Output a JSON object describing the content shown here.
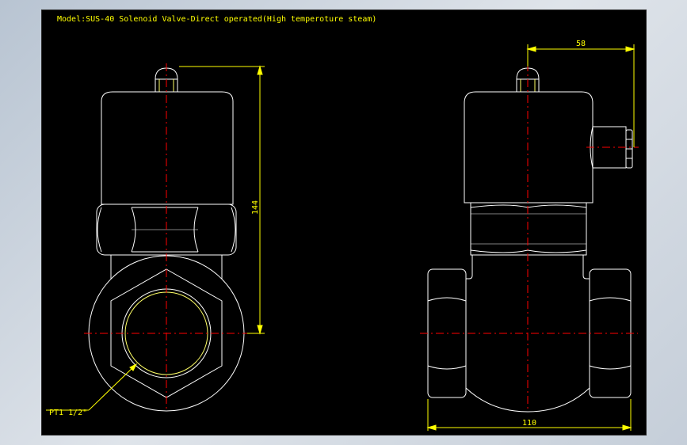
{
  "drawing": {
    "title": "Model:SUS-40 Solenoid Valve-Direct operated(High temperoture steam)",
    "dim_height": "144",
    "dim_top_right": "58",
    "dim_width": "110",
    "thread_label": "PT1 1/2\""
  },
  "colors": {
    "background": "#000000",
    "outline": "#ffffff",
    "centerline": "#ff0000",
    "dimension": "#ffff00",
    "thread": "#ffff66"
  }
}
